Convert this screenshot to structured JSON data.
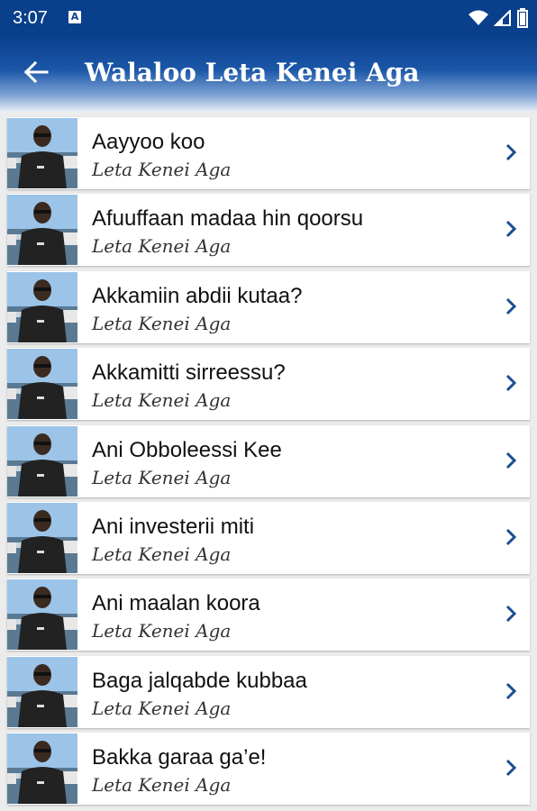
{
  "status_bar": {
    "time": "3:07",
    "notification_letter": "A",
    "icons": [
      "wifi-icon",
      "signal-icon",
      "battery-icon"
    ]
  },
  "app_bar": {
    "title": "Walaloo Leta Kenei Aga",
    "back_icon": "arrow-left-icon"
  },
  "colors": {
    "primary": "#0a3f8c",
    "chevron": "#1c4f91",
    "list_bg": "#ececec",
    "card_bg": "#ffffff"
  },
  "list": {
    "items": [
      {
        "title": "Aayyoo koo",
        "subtitle": "Leta Kenei Aga"
      },
      {
        "title": "Afuuffaan madaa hin qoorsu",
        "subtitle": "Leta Kenei Aga"
      },
      {
        "title": "Akkamiin abdii kutaa?",
        "subtitle": "Leta Kenei Aga"
      },
      {
        "title": "Akkamitti sirreessu?",
        "subtitle": "Leta Kenei Aga"
      },
      {
        "title": "Ani Obboleessi Kee",
        "subtitle": "Leta Kenei Aga"
      },
      {
        "title": "Ani investerii miti",
        "subtitle": "Leta Kenei Aga"
      },
      {
        "title": "Ani maalan koora",
        "subtitle": "Leta Kenei Aga"
      },
      {
        "title": "Baga jalqabde kubbaa",
        "subtitle": "Leta Kenei Aga"
      },
      {
        "title": "Bakka garaa ga’e!",
        "subtitle": "Leta Kenei Aga"
      }
    ]
  }
}
